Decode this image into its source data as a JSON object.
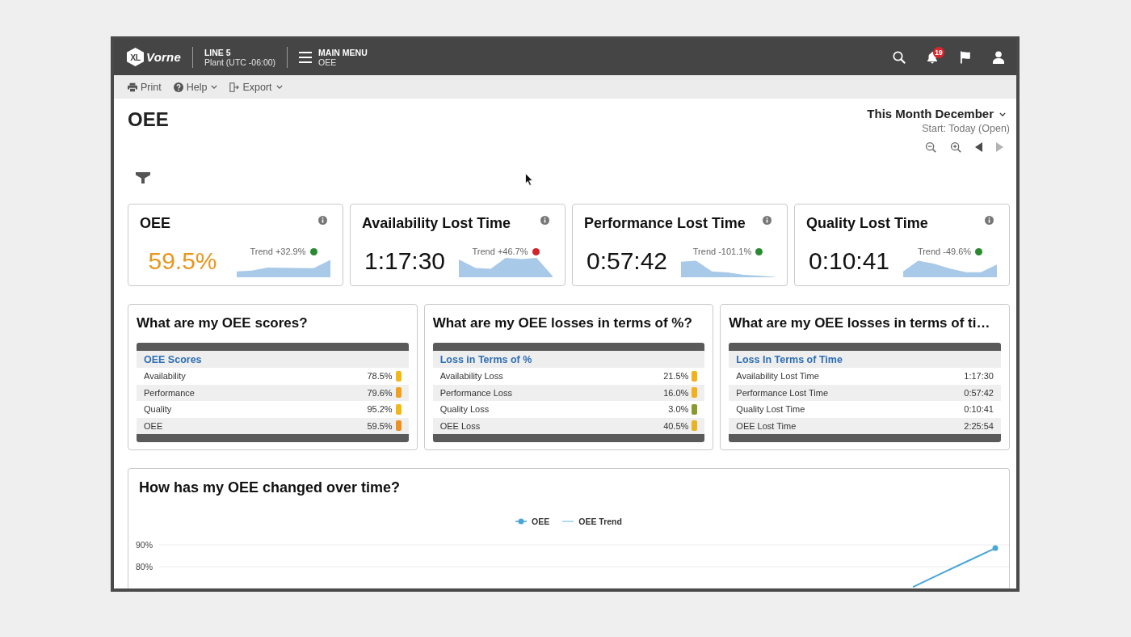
{
  "header": {
    "logo_mark": "XL",
    "brand": "Vorne",
    "line": {
      "name": "LINE 5",
      "zone": "Plant (UTC -06:00)"
    },
    "menu": {
      "label": "MAIN MENU",
      "current": "OEE"
    },
    "notification_count": "19"
  },
  "toolbar": [
    {
      "kind": "print",
      "label": "Print",
      "dropdown": false
    },
    {
      "kind": "help",
      "label": "Help",
      "dropdown": true
    },
    {
      "kind": "export",
      "label": "Export",
      "dropdown": true
    }
  ],
  "page_title": "OEE",
  "period": {
    "label": "This Month December",
    "start": "Start: Today (Open)",
    "nav_buttons": [
      {
        "kind": "zoom_out",
        "disabled": false
      },
      {
        "kind": "zoom_in",
        "disabled": false
      },
      {
        "kind": "previous",
        "disabled": false
      },
      {
        "kind": "next",
        "disabled": true
      }
    ]
  },
  "kpi_cards": [
    {
      "title": "OEE",
      "value": {
        "text": "59.5%",
        "color": "#e8961c"
      },
      "trend": {
        "label": "Trend +32.9%",
        "color": "#2a8a32"
      }
    },
    {
      "title": "Availability Lost Time",
      "value": {
        "text": "1:17:30",
        "color": "#111111"
      },
      "trend": {
        "label": "Trend +46.7%",
        "color": "#d4242a"
      }
    },
    {
      "title": "Performance Lost Time",
      "value": {
        "text": "0:57:42",
        "color": "#111111"
      },
      "trend": {
        "label": "Trend -101.1%",
        "color": "#2a8a32"
      }
    },
    {
      "title": "Quality Lost Time",
      "value": {
        "text": "0:10:41",
        "color": "#111111"
      },
      "trend": {
        "label": "Trend -49.6%",
        "color": "#2a8a32"
      }
    }
  ],
  "score_tables": [
    {
      "title": "What are my OEE scores?",
      "table_title": "OEE Scores",
      "rows": [
        {
          "label": "Availability",
          "value": "78.5%",
          "color": "#f2b817"
        },
        {
          "label": "Performance",
          "value": "79.6%",
          "color": "#f0a01e"
        },
        {
          "label": "Quality",
          "value": "95.2%",
          "color": "#f2b817"
        },
        {
          "label": "OEE",
          "value": "59.5%",
          "color": "#ec9020"
        }
      ]
    },
    {
      "title": "What are my OEE losses in terms of %?",
      "table_title": "Loss in Terms of %",
      "rows": [
        {
          "label": "Availability Loss",
          "value": "21.5%",
          "color": "#f2b01a"
        },
        {
          "label": "Performance Loss",
          "value": "16.0%",
          "color": "#f2b01a"
        },
        {
          "label": "Quality Loss",
          "value": "3.0%",
          "color": "#8a9a2c"
        },
        {
          "label": "OEE Loss",
          "value": "40.5%",
          "color": "#e9b421"
        }
      ]
    },
    {
      "title": "What are my OEE losses in terms of ti…",
      "table_title": "Loss In Terms of Time",
      "rows": [
        {
          "label": "Availability Lost Time",
          "value": "1:17:30"
        },
        {
          "label": "Performance Lost Time",
          "value": "0:57:42"
        },
        {
          "label": "Quality Lost Time",
          "value": "0:10:41"
        },
        {
          "label": "OEE Lost Time",
          "value": "2:25:54"
        }
      ]
    }
  ],
  "oee_chart": {
    "title": "How has my OEE changed over time?",
    "chart_data": {
      "type": "line",
      "categories": [
        null,
        null,
        null,
        null,
        null,
        null,
        null,
        null,
        null,
        null,
        null,
        null,
        null,
        null,
        null,
        null,
        null,
        null,
        null,
        null,
        null,
        null,
        null,
        null,
        null,
        null,
        null,
        null,
        null,
        null,
        null
      ],
      "ylim": [
        70,
        90
      ],
      "yticks": [
        {
          "value": 80,
          "label": "80%"
        },
        {
          "value": 90,
          "label": "90%"
        }
      ],
      "series": [
        {
          "name": "OEE",
          "color": "#4aa6d6",
          "values": [
            null,
            null,
            null,
            null,
            null,
            null,
            null,
            null,
            null,
            null,
            null,
            null,
            null,
            null,
            null,
            null,
            null,
            null,
            null,
            null,
            null,
            null,
            null,
            null,
            null,
            null,
            null,
            70.7,
            76.7,
            82.6,
            88.5
          ]
        },
        {
          "name": "OEE Trend",
          "color": "#9fd2ee",
          "values": [
            null,
            null,
            null,
            null,
            null,
            null,
            null,
            null,
            null,
            null,
            null,
            null,
            null,
            null,
            null,
            null,
            null,
            null,
            null,
            null,
            null,
            null,
            null,
            null,
            null,
            null,
            null,
            null,
            null,
            null,
            null
          ]
        }
      ]
    }
  }
}
